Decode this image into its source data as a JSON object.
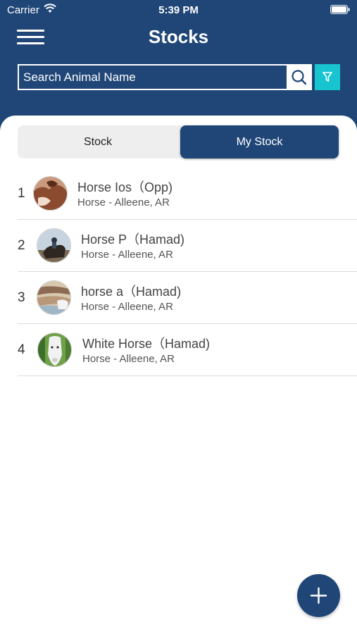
{
  "status_bar": {
    "carrier": "Carrier",
    "time": "5:39 PM"
  },
  "header": {
    "title": "Stocks"
  },
  "search": {
    "placeholder": "Search Animal Name"
  },
  "segments": {
    "stock_label": "Stock",
    "my_stock_label": "My Stock",
    "selected": "My Stock"
  },
  "animals": [
    {
      "index": "1",
      "name": "Horse Ios（Opp)",
      "subtitle": "Horse - Alleene, AR"
    },
    {
      "index": "2",
      "name": "Horse P（Hamad)",
      "subtitle": "Horse - Alleene, AR"
    },
    {
      "index": "3",
      "name": "horse a（Hamad)",
      "subtitle": "Horse - Alleene, AR"
    },
    {
      "index": "4",
      "name": "White Horse（Hamad)",
      "subtitle": "Horse - Alleene, AR"
    }
  ],
  "icons": {
    "menu": "hamburger-menu-icon",
    "search": "search-icon",
    "filter": "filter-icon",
    "add": "plus-icon",
    "wifi": "wifi-icon",
    "battery": "battery-icon"
  },
  "colors": {
    "primary": "#1f4677",
    "accent": "#17c4cf",
    "segment_bg": "#eeeeee",
    "divider": "#dcdcdc"
  }
}
